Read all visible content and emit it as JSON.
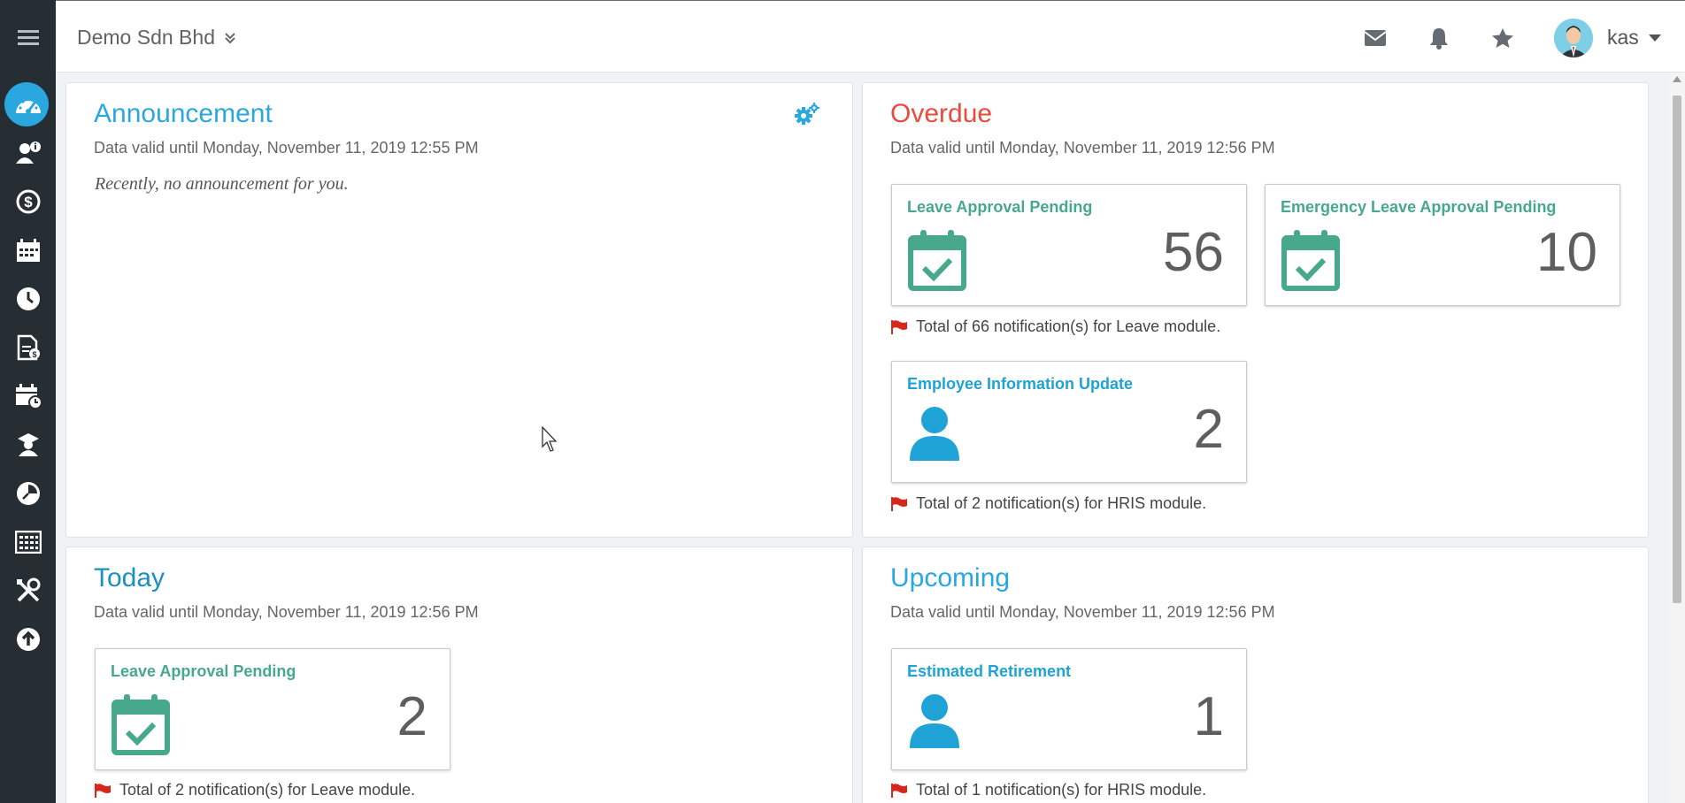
{
  "company": "Demo Sdn Bhd",
  "user": {
    "name": "kas"
  },
  "colors": {
    "accent": "#2ba7e0",
    "overdue": "#e74c3c",
    "leave_green": "#47a88b",
    "hris_blue": "#1fa2d6",
    "flag_red": "#d9261c"
  },
  "sidebar": {
    "items": [
      {
        "icon": "dashboard-icon"
      },
      {
        "icon": "employee-info-icon"
      },
      {
        "icon": "payroll-icon"
      },
      {
        "icon": "calendar-icon"
      },
      {
        "icon": "time-attendance-icon"
      },
      {
        "icon": "claims-icon"
      },
      {
        "icon": "schedule-icon"
      },
      {
        "icon": "training-icon"
      },
      {
        "icon": "timesheet-icon"
      },
      {
        "icon": "calculator-icon"
      },
      {
        "icon": "tools-icon"
      },
      {
        "icon": "upload-icon"
      }
    ]
  },
  "announcement": {
    "title": "Announcement",
    "valid": "Data valid until Monday, November 11, 2019 12:55 PM",
    "empty": "Recently, no announcement for you."
  },
  "overdue": {
    "title": "Overdue",
    "valid": "Data valid until Monday, November 11, 2019 12:56 PM",
    "tiles": [
      {
        "label": "Leave Approval Pending",
        "count": "56",
        "icon": "calendar-check-icon"
      },
      {
        "label": "Emergency Leave Approval Pending",
        "count": "10",
        "icon": "calendar-check-icon"
      },
      {
        "label": "Employee Information Update",
        "count": "2",
        "icon": "user-icon"
      }
    ],
    "notes": [
      "Total of 66 notification(s) for Leave module.",
      "Total of 2 notification(s) for HRIS module."
    ]
  },
  "today": {
    "title": "Today",
    "valid": "Data valid until Monday, November 11, 2019 12:56 PM",
    "tiles": [
      {
        "label": "Leave Approval Pending",
        "count": "2",
        "icon": "calendar-check-icon"
      }
    ],
    "notes": [
      "Total of 2 notification(s) for Leave module."
    ]
  },
  "upcoming": {
    "title": "Upcoming",
    "valid": "Data valid until Monday, November 11, 2019 12:56 PM",
    "tiles": [
      {
        "label": "Estimated Retirement",
        "count": "1",
        "icon": "user-icon"
      }
    ],
    "notes": [
      "Total of 1 notification(s) for HRIS module."
    ]
  }
}
